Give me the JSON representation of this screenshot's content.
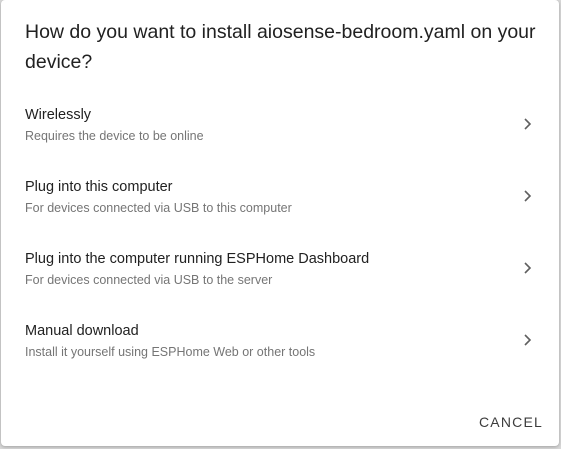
{
  "dialog": {
    "title": "How do you want to install aiosense-bedroom.yaml on your device?",
    "options": [
      {
        "label": "Wirelessly",
        "description": "Requires the device to be online",
        "icon": "chevron-right-icon"
      },
      {
        "label": "Plug into this computer",
        "description": "For devices connected via USB to this computer",
        "icon": "chevron-right-icon"
      },
      {
        "label": "Plug into the computer running ESPHome Dashboard",
        "description": "For devices connected via USB to the server",
        "icon": "chevron-right-icon"
      },
      {
        "label": "Manual download",
        "description": "Install it yourself using ESPHome Web or other tools",
        "icon": "chevron-right-icon"
      }
    ],
    "cancel_label": "CANCEL"
  },
  "colors": {
    "backdrop": "#d8d8d8",
    "surface": "#ffffff",
    "primary_text": "#212121",
    "secondary_text": "#757575"
  }
}
